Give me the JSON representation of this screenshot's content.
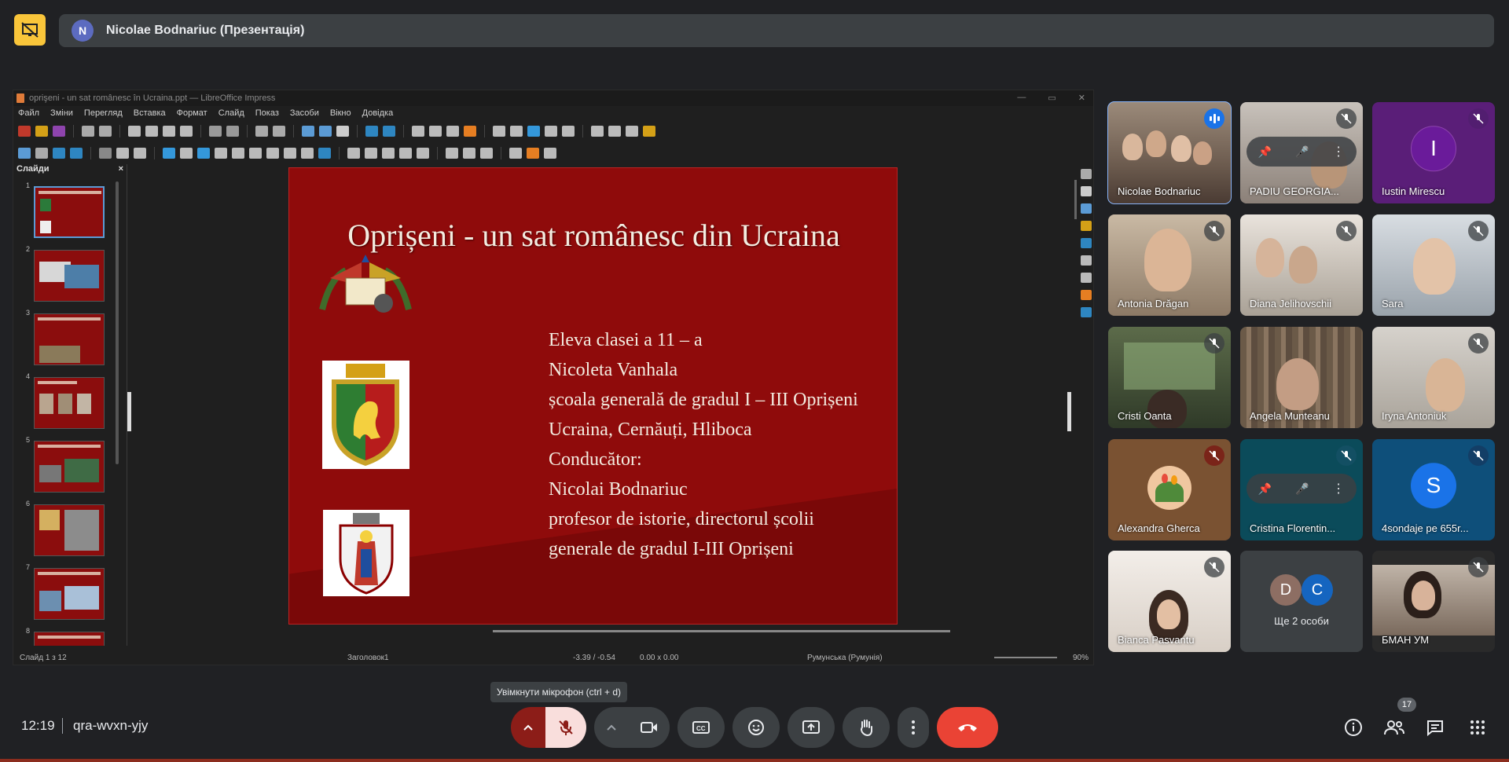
{
  "presentation_bar": {
    "avatar_letter": "N",
    "presenter_label": "Nicolae Bodnariuc (Презентація)"
  },
  "libreoffice": {
    "window_title": "oprişeni - un sat românesc în Ucraina.ppt — LibreOffice Impress",
    "menu": [
      "Файл",
      "Зміни",
      "Перегляд",
      "Вставка",
      "Формат",
      "Слайд",
      "Показ",
      "Засоби",
      "Вікно",
      "Довідка"
    ],
    "slides_pane_title": "Слайди",
    "thumbnails": [
      "1",
      "2",
      "3",
      "4",
      "5",
      "6",
      "7",
      "8"
    ],
    "slide": {
      "title": "Oprișeni - un sat românesc din Ucraina",
      "lines": [
        "Eleva clasei a 11 – a",
        "Nicoleta Vanhala",
        "școala generală de gradul I – III Oprișeni",
        "Ucraina, Cernăuți, Hliboca",
        "Conducător:",
        "Nicolai Bodnariuc",
        "profesor de istorie, directorul școlii",
        "generale de gradul I-III Oprișeni"
      ]
    },
    "status": {
      "slide_count": "Слайд 1 з 12",
      "layout_name": "Заголовок1",
      "cursor_pos": "-3.39 / -0.54",
      "object_size": "0.00 x 0.00",
      "language": "Румунська (Румунія)",
      "zoom": "90%"
    }
  },
  "participants": [
    {
      "name": "Nicolae Bodnariuc",
      "state": "speaking"
    },
    {
      "name": "PADIU GEORGIA...",
      "state": "muted"
    },
    {
      "name": "Iustin Mirescu",
      "state": "muted",
      "letter": "I",
      "avatar_color": "#6a1b9a"
    },
    {
      "name": "Antonia Drăgan",
      "state": "muted"
    },
    {
      "name": "Diana Jelihovschii",
      "state": "muted"
    },
    {
      "name": "Sara",
      "state": "muted"
    },
    {
      "name": "Cristi Oanta",
      "state": "muted"
    },
    {
      "name": "Angela Munteanu",
      "state": "muted"
    },
    {
      "name": "Iryna Antoniuk",
      "state": "muted"
    },
    {
      "name": "Alexandra Gherca",
      "state": "muted"
    },
    {
      "name": "Cristina Florentin...",
      "state": "muted"
    },
    {
      "name": "4sondaje pe 655r...",
      "state": "muted",
      "letter": "S",
      "avatar_color": "#1a73e8"
    },
    {
      "name": "Bianca Pasvantu",
      "state": "muted"
    },
    {
      "name": "Ще 2 особи",
      "state": "group",
      "letters": [
        "D",
        "C"
      ]
    },
    {
      "name": "БМАН УМ",
      "state": "muted"
    }
  ],
  "bottom_bar": {
    "time": "12:19",
    "meeting_code": "qra-wvxn-yjy",
    "tooltip": "Увімкнути мікрофон (ctrl + d)",
    "participant_count": "17"
  },
  "colors": {
    "background": "#202124",
    "slide_red": "#8f0b0b",
    "end_call": "#ea4335",
    "mic_off_bg": "#f9dedc",
    "accent_blue": "#8ab4f8"
  }
}
